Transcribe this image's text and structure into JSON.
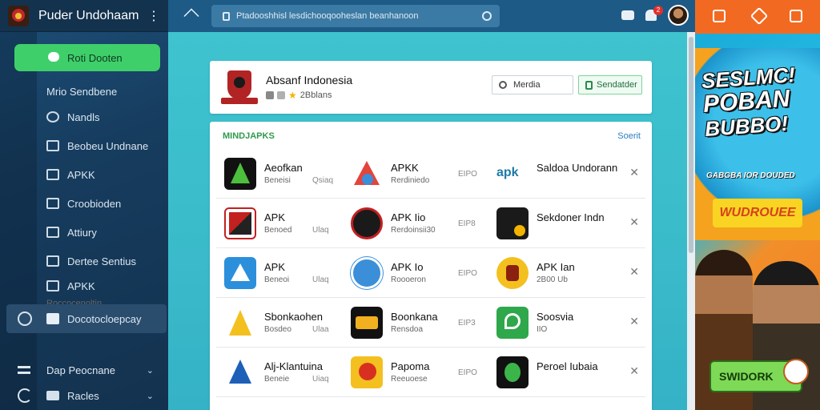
{
  "app": {
    "title": "Puder Undohaam",
    "more_icon": "kebab-icon"
  },
  "sidebar": {
    "primary_button": "Roti Dooten",
    "items": [
      {
        "label": "Mrio Sendbene",
        "icon": "none"
      },
      {
        "label": "Nandls",
        "icon": "circle-icon"
      },
      {
        "label": "Beobeu Undnane",
        "icon": "inbox-icon"
      },
      {
        "label": "APKK",
        "icon": "chart-icon"
      },
      {
        "label": "Croobioden",
        "icon": "square-icon"
      },
      {
        "label": "Attiury",
        "icon": "list-icon"
      },
      {
        "label": "Dertee Sentius",
        "icon": "doc-icon"
      },
      {
        "label": "APKK",
        "icon": "grid-icon"
      },
      {
        "label": "Roccocenoltin",
        "icon": "none"
      },
      {
        "label": "Docotocloepcay",
        "icon": "check-icon"
      }
    ],
    "bottom_items": [
      {
        "label": "Dap Peocnane"
      },
      {
        "label": "Racles"
      }
    ]
  },
  "topbar": {
    "search_text": "Ptadooshhisl lesdichooqooheslan beanhanoon",
    "notif_count": "2"
  },
  "header_card": {
    "title": "Absanf Indonesia",
    "meta_text": "2Bblans",
    "search_value": "Merdia",
    "button_label": "Sendatder"
  },
  "list": {
    "heading": "MINDJAPKS",
    "sort_label": "Soerit",
    "rows": [
      {
        "c1": {
          "name": "Aeofkan",
          "sub": "Beneisi",
          "size": "Qsiaq"
        },
        "c2": {
          "name": "APKK",
          "sub": "Rerdiniedo",
          "size": "EIPO"
        },
        "c3": {
          "name": "Saldoa Undorann",
          "sub": ""
        }
      },
      {
        "c1": {
          "name": "APK",
          "sub": "Benoed",
          "size": "Ulaq"
        },
        "c2": {
          "name": "APK Iio",
          "sub": "Rerdoinsii30",
          "size": "EIP8"
        },
        "c3": {
          "name": "Sekdoner Indn",
          "sub": ""
        }
      },
      {
        "c1": {
          "name": "APK",
          "sub": "Beneoi",
          "size": "Ulaq"
        },
        "c2": {
          "name": "APK Io",
          "sub": "Roooeron",
          "size": "EIPO"
        },
        "c3": {
          "name": "APK Ian",
          "sub": "2B00 Ub"
        }
      },
      {
        "c1": {
          "name": "Sbonkaohen",
          "sub": "Bosdeo",
          "size": "Ulaa"
        },
        "c2": {
          "name": "Boonkana",
          "sub": "Rensdoa",
          "size": "EIP3"
        },
        "c3": {
          "name": "Soosvia",
          "sub": "IIO"
        }
      },
      {
        "c1": {
          "name": "Alj-Klantuina",
          "sub": "Beneie",
          "size": "Uiaq"
        },
        "c2": {
          "name": "Papoma",
          "sub": "Reeuoese",
          "size": "EIPO"
        },
        "c3": {
          "name": "Peroel Iubaia",
          "sub": ""
        }
      }
    ]
  },
  "ad": {
    "headline_1": "SESLMC!",
    "headline_2": "POBAN",
    "headline_3": "BUBBO!",
    "subline": "GABGBA IOR DOUDED",
    "pill": "WUDROUEE",
    "cta": "SWIDORK"
  },
  "colors": {
    "accent_green": "#3fcf6a",
    "topbar": "#1d5a86",
    "main_bg": "#3ec3cf",
    "ad_orange": "#f26a22"
  }
}
